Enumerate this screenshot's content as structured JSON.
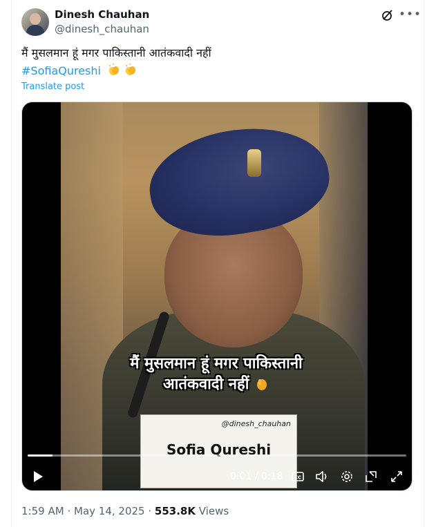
{
  "author": {
    "name": "Dinesh Chauhan",
    "handle": "@dinesh_chauhan"
  },
  "post": {
    "text": "मैं मुसलमान हूं मगर पाकिस्तानी आतंकवादी नहीं",
    "hashtag": "#SofiaQureshi",
    "emoji_icon": "clapping-hands-icon",
    "translate_label": "Translate post"
  },
  "video": {
    "caption": "मैं मुसलमान हूं मगर पाकिस्तानी आतंकवादी नहीं",
    "nameplate_handle": "@dinesh_chauhan",
    "nameplate_name": "Sofia Qureshi",
    "time_display": "0:01 / 0:18",
    "progress": 0.065
  },
  "meta": {
    "time": "1:59 AM",
    "date": "May 14, 2025",
    "separator": "·",
    "views_count": "553.8K",
    "views_label": "Views"
  },
  "icons": {
    "grok": "grok-icon",
    "more": "more-icon",
    "play": "play-icon",
    "cc": "captions-icon",
    "volume": "volume-icon",
    "settings": "settings-icon",
    "pip": "pip-icon",
    "fullscreen": "fullscreen-icon"
  },
  "colors": {
    "accent": "#1d9bf0",
    "text": "#0f1419",
    "secondary": "#536471"
  }
}
